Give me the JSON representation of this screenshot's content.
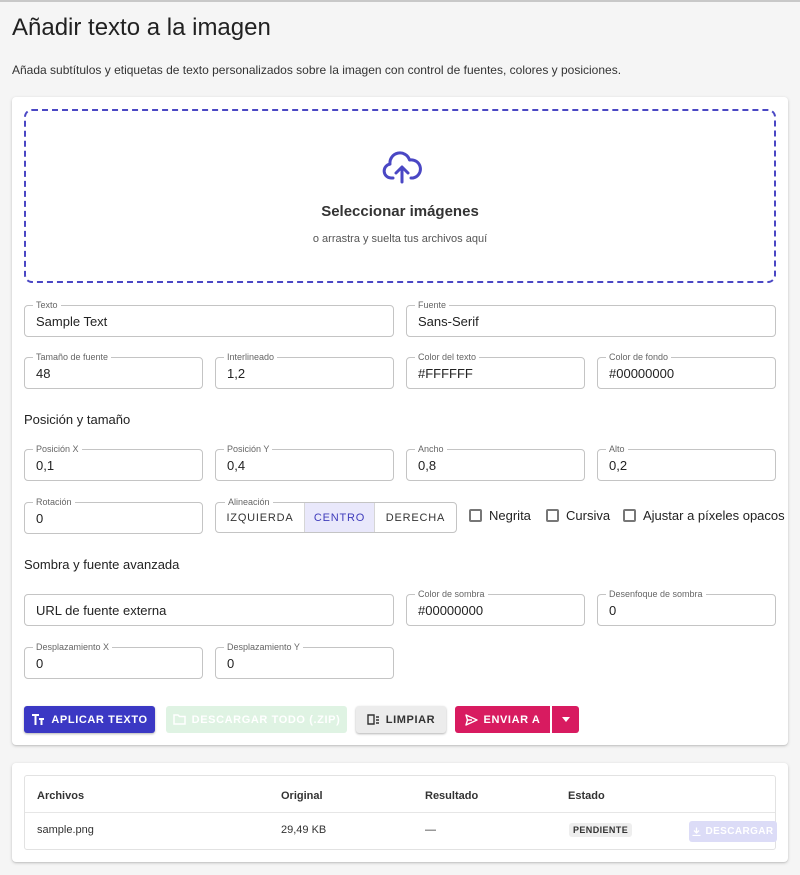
{
  "page": {
    "title": "Añadir texto a la imagen",
    "subtitle": "Añada subtítulos y etiquetas de texto personalizados sobre la imagen con control de fuentes, colores y posiciones."
  },
  "dropzone": {
    "icon": "cloud-upload-icon",
    "title": "Seleccionar imágenes",
    "hint": "o arrastra y suelta tus archivos aquí",
    "accent": "#4a47c4"
  },
  "fields": {
    "text": {
      "label": "Texto",
      "value": "Sample Text"
    },
    "font": {
      "label": "Fuente",
      "value": "Sans-Serif"
    },
    "font_size": {
      "label": "Tamaño de fuente",
      "value": "48"
    },
    "line_height": {
      "label": "Interlineado",
      "value": "1,2"
    },
    "text_color": {
      "label": "Color del texto",
      "value": "#FFFFFF"
    },
    "bg_color": {
      "label": "Color de fondo",
      "value": "#00000000"
    },
    "pos_x": {
      "label": "Posición X",
      "value": "0,1"
    },
    "pos_y": {
      "label": "Posición Y",
      "value": "0,4"
    },
    "width": {
      "label": "Ancho",
      "value": "0,8"
    },
    "height": {
      "label": "Alto",
      "value": "0,2"
    },
    "rotation": {
      "label": "Rotación",
      "value": "0"
    },
    "font_url": {
      "placeholder": "URL de fuente externa"
    },
    "shadow_color": {
      "label": "Color de sombra",
      "value": "#00000000"
    },
    "shadow_blur": {
      "label": "Desenfoque de sombra",
      "value": "0"
    },
    "offset_x": {
      "label": "Desplazamiento X",
      "value": "0"
    },
    "offset_y": {
      "label": "Desplazamiento Y",
      "value": "0"
    }
  },
  "sections": {
    "position": "Posición y tamaño",
    "shadow": "Sombra y fuente avanzada"
  },
  "alignment": {
    "label": "Alineación",
    "options": [
      "IZQUIERDA",
      "CENTRO",
      "DERECHA"
    ],
    "selected": "CENTRO"
  },
  "checkboxes": {
    "bold": {
      "label": "Negrita",
      "checked": false
    },
    "italic": {
      "label": "Cursiva",
      "checked": false
    },
    "fit_opaque": {
      "label": "Ajustar a píxeles opacos",
      "checked": false
    }
  },
  "actions": {
    "apply": "APLICAR TEXTO",
    "download_all": "DESCARGAR TODO (.ZIP)",
    "clear": "LIMPIAR",
    "send_to": "ENVIAR A",
    "apply_color": "#3b38c4",
    "send_color": "#d81b60"
  },
  "table": {
    "headers": [
      "Archivos",
      "Original",
      "Resultado",
      "Estado"
    ],
    "rows": [
      {
        "file": "sample.png",
        "original": "29,49 KB",
        "result": "—",
        "status": "PENDIENTE",
        "action": "DESCARGAR"
      }
    ]
  }
}
